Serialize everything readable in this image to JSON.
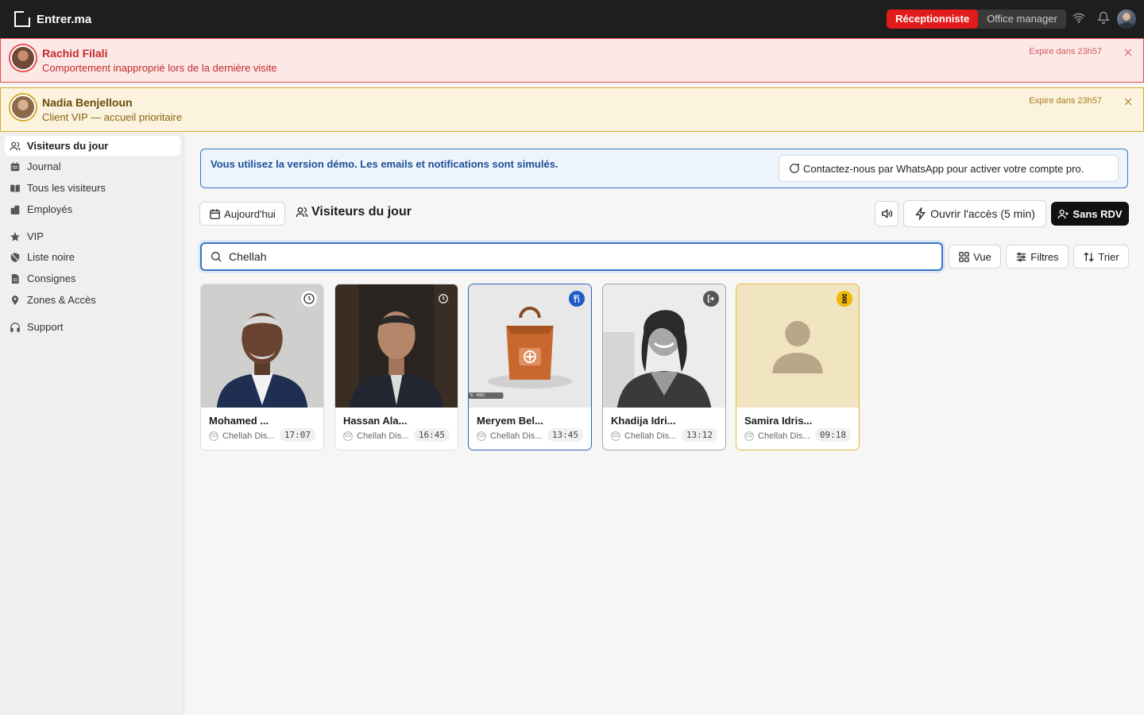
{
  "topbar": {
    "brand": "Entrer.ma",
    "roles": [
      "Réceptionniste",
      "Office manager"
    ],
    "active_role": "Réceptionniste",
    "icons": [
      "wifi-icon",
      "bell-icon",
      "user-avatar"
    ]
  },
  "alerts": [
    {
      "name": "Rachid Filali",
      "message": "Comportement inapproprié lors de la dernière visite",
      "expires": "Expire dans 23h57",
      "level": "red"
    },
    {
      "name": "Nadia Benjelloun",
      "message": "Client VIP — accueil prioritaire",
      "expires": "Expire dans 23h57",
      "level": "yellow"
    }
  ],
  "sidebar": {
    "items": [
      {
        "label": "Visiteurs du jour",
        "icon": "users-icon",
        "active": true
      },
      {
        "label": "Journal",
        "icon": "calendar-icon"
      },
      {
        "label": "Tous les visiteurs",
        "icon": "book-icon"
      },
      {
        "label": "Employés",
        "icon": "building-icon"
      },
      {
        "label": "VIP",
        "icon": "star-icon"
      },
      {
        "label": "Liste noire",
        "icon": "shield-icon"
      },
      {
        "label": "Consignes",
        "icon": "document-icon"
      },
      {
        "label": "Zones & Accès",
        "icon": "map-pin-icon"
      },
      {
        "label": "Support",
        "icon": "headphones-icon"
      }
    ]
  },
  "demo_banner": {
    "text": "Vous utilisez la version démo. Les emails et notifications sont simulés.",
    "cta": "Contactez-nous par WhatsApp pour activer votre compte pro."
  },
  "toolbar": {
    "date_button": "Aujourd'hui",
    "title": "Visiteurs du jour",
    "open_access": "Ouvrir l'accès (5 min)",
    "walk_in": "Sans RDV",
    "view": "Vue",
    "filters": "Filtres",
    "sort": "Trier"
  },
  "search": {
    "value": "Chellah",
    "placeholder": ""
  },
  "visitors": [
    {
      "name": "Mohamed ...",
      "company": "Chellah Dis...",
      "time": "17:07",
      "status": "pending-clock-icon",
      "state": "default"
    },
    {
      "name": "Hassan Ala...",
      "company": "Chellah Dis...",
      "time": "16:45",
      "status": "pending-clock-icon",
      "state": "default"
    },
    {
      "name": "Meryem Bel...",
      "company": "Chellah Dis...",
      "time": "13:45",
      "status": "restaurant-icon",
      "state": "lunch",
      "photo_caption": "S · RDC"
    },
    {
      "name": "Khadija Idri...",
      "company": "Chellah Dis...",
      "time": "13:12",
      "status": "exit-icon",
      "state": "left"
    },
    {
      "name": "Samira Idris...",
      "company": "Chellah Dis...",
      "time": "09:18",
      "status": "hourglass-icon",
      "state": "waiting"
    }
  ],
  "company_badge": "CD",
  "colors": {
    "accent_red": "#e21b1b",
    "accent_blue": "#2a63b8",
    "warning": "#e8b73a"
  }
}
